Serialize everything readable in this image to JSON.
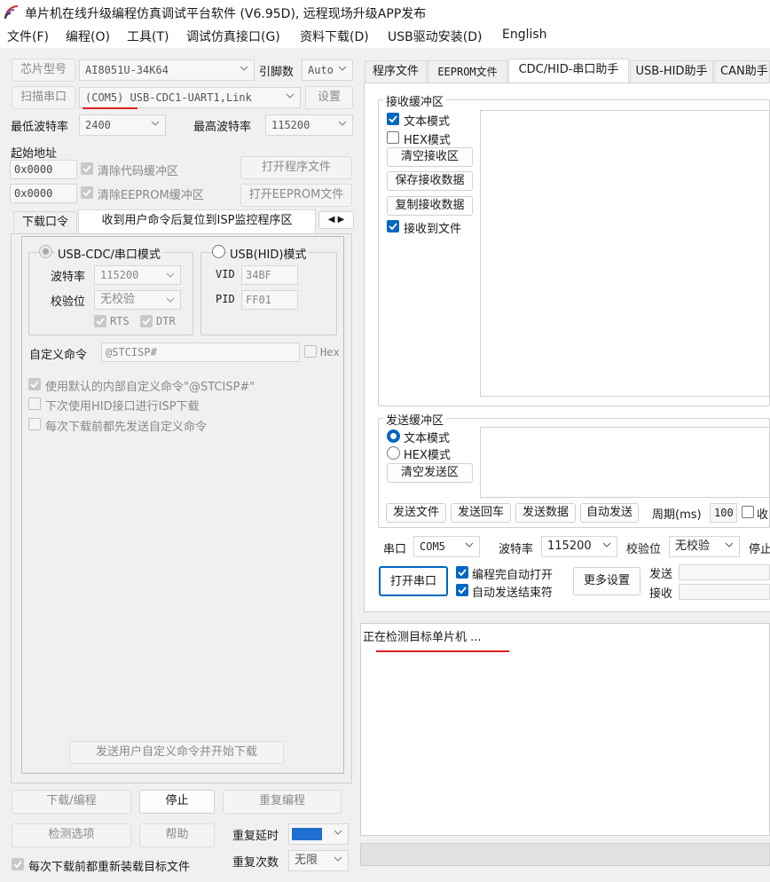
{
  "window": {
    "title": "单片机在线升级编程仿真调试平台软件 (V6.95D), 远程现场升级APP发布"
  },
  "menu": [
    "文件(F)",
    "编程(O)",
    "工具(T)",
    "调试仿真接口(G)",
    "资料下载(D)",
    "USB驱动安装(D)",
    "English"
  ],
  "left": {
    "chip_label": "芯片型号",
    "chip_value": "AI8051U-34K64",
    "pin_label": "引脚数",
    "pin_value": "Auto",
    "scan_label": "扫描串口",
    "port_value": "(COM5) USB-CDC1-UART1,Link",
    "settings_label": "设置",
    "min_baud_label": "最低波特率",
    "min_baud_value": "2400",
    "max_baud_label": "最高波特率",
    "max_baud_value": "115200",
    "start_addr_label": "起始地址",
    "addr1": "0x0000",
    "clear_code_label": "清除代码缓冲区",
    "open_prog_label": "打开程序文件",
    "addr2": "0x0000",
    "clear_eeprom_label": "清除EEPROM缓冲区",
    "open_eeprom_label": "打开EEPROM文件",
    "tabs": [
      "下载口令",
      "收到用户命令后复位到ISP监控程序区"
    ],
    "cdc_mode_label": "USB-CDC/串口模式",
    "hid_mode_label": "USB(HID)模式",
    "baud_label": "波特率",
    "baud_value": "115200",
    "parity_label": "校验位",
    "parity_value": "无校验",
    "rts_label": "RTS",
    "dtr_label": "DTR",
    "vid_label": "VID",
    "vid_value": "34BF",
    "pid_label": "PID",
    "pid_value": "FF01",
    "custom_cmd_label": "自定义命令",
    "custom_cmd_value": "@STCISP#",
    "hex_label": "Hex",
    "opt1": "使用默认的内部自定义命令\"@STCISP#\"",
    "opt2": "下次使用HID接口进行ISP下载",
    "opt3": "每次下载前都先发送自定义命令",
    "send_custom_label": "发送用户自定义命令并开始下载",
    "download_label": "下载/编程",
    "stop_label": "停止",
    "reprogram_label": "重复编程",
    "check_options_label": "检测选项",
    "help_label": "帮助",
    "repeat_delay_label": "重复延时",
    "repeat_count_label": "重复次数",
    "repeat_count_value": "无限",
    "reload_label": "每次下载前都重新装载目标文件"
  },
  "right": {
    "tabs": [
      "程序文件",
      "EEPROM文件",
      "CDC/HID-串口助手",
      "USB-HID助手",
      "CAN助手"
    ],
    "recv_group": "接收缓冲区",
    "recv_text_mode": "文本模式",
    "recv_hex_mode": "HEX模式",
    "clear_recv": "清空接收区",
    "save_recv": "保存接收数据",
    "copy_recv": "复制接收数据",
    "recv_to_file": "接收到文件",
    "send_group": "发送缓冲区",
    "send_text_mode": "文本模式",
    "send_hex_mode": "HEX模式",
    "clear_send": "清空发送区",
    "send_file": "发送文件",
    "send_cr": "发送回车",
    "send_data": "发送数据",
    "auto_send": "自动发送",
    "period_label": "周期(ms)",
    "period_value": "100",
    "recv_trunc": "收",
    "port_label": "串口",
    "port_value": "COM5",
    "baud_label": "波特率",
    "baud_value": "115200",
    "parity_label": "校验位",
    "parity_value": "无校验",
    "stop_trunc": "停止",
    "open_port": "打开串口",
    "auto_open": "编程完自动打开",
    "auto_end": "自动发送结束符",
    "more_settings": "更多设置",
    "send_stat": "发送",
    "recv_stat": "接收",
    "status_text": "正在检测目标单片机 ..."
  },
  "accent_color": "#0067c0",
  "annotation_color": "#e02020"
}
